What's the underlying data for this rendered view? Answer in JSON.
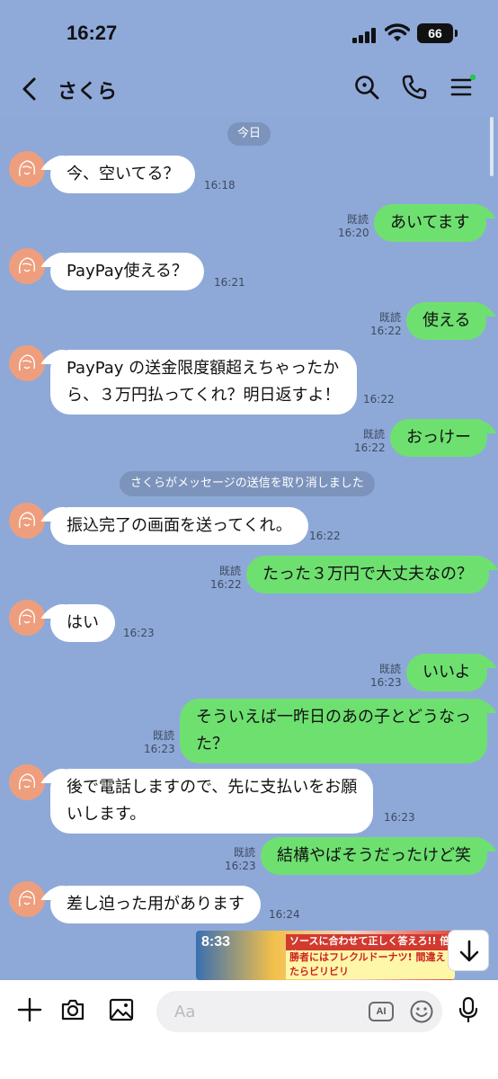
{
  "status_bar": {
    "time": "16:27",
    "battery": "66"
  },
  "header": {
    "title": "さくら"
  },
  "chat": {
    "date_label": "今日",
    "notice": "さくらがメッセージの送信を取り消しました",
    "messages": [
      {
        "side": "in",
        "lines": [
          "今、空いてる？"
        ],
        "time": "16:18"
      },
      {
        "side": "out",
        "lines": [
          "あいてます"
        ],
        "read": "既読",
        "time": "16:20"
      },
      {
        "side": "in",
        "lines": [
          "PayPay使える？"
        ],
        "time": "16:21"
      },
      {
        "side": "out",
        "lines": [
          "使える"
        ],
        "read": "既読",
        "time": "16:22"
      },
      {
        "side": "in",
        "lines": [
          "PayPay の送金限度額超えちゃったか",
          "ら、３万円払ってくれ？明日返すよ！"
        ],
        "time": "16:22"
      },
      {
        "side": "out",
        "lines": [
          "おっけー"
        ],
        "read": "既読",
        "time": "16:22"
      },
      {
        "side": "in",
        "lines": [
          "振込完了の画面を送ってくれ。"
        ],
        "time": "16:22"
      },
      {
        "side": "out",
        "lines": [
          "たった３万円で大丈夫なの？"
        ],
        "read": "既読",
        "time": "16:22"
      },
      {
        "side": "in",
        "lines": [
          "はい"
        ],
        "time": "16:23"
      },
      {
        "side": "out",
        "lines": [
          "いいよ"
        ],
        "read": "既読",
        "time": "16:23"
      },
      {
        "side": "out",
        "lines": [
          "そういえば一昨日のあの子とどうなっ",
          "た？"
        ],
        "read": "既読",
        "time": "16:23"
      },
      {
        "side": "in",
        "lines": [
          "後で電話しますので、先に支払いをお願",
          "いします。"
        ],
        "time": "16:23"
      },
      {
        "side": "out",
        "lines": [
          "結構やばそうだったけど笑"
        ],
        "read": "既読",
        "time": "16:23"
      },
      {
        "side": "in",
        "lines": [
          "差し迫った用があります"
        ],
        "time": "16:24"
      }
    ]
  },
  "video_overlay": {
    "clock": "8:33",
    "caption_top": "ソースに合わせて正しく答えろ!! 倍倍FIGHT",
    "caption_bottom": "勝者にはフレクルドーナツ! 間違えたらビリビリ"
  },
  "input_bar": {
    "placeholder": "Aa",
    "ai_label": "AI"
  },
  "colors": {
    "background": "#8ea9d8",
    "outgoing": "#6ee070",
    "incoming": "#ffffff",
    "avatar": "#ee9e7d"
  }
}
